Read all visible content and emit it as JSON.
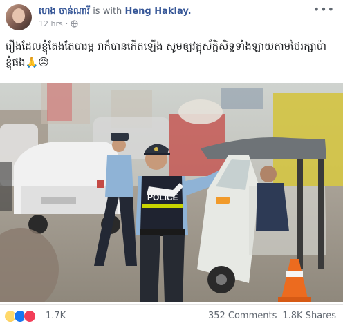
{
  "post": {
    "author": "ហេង ចាន់ណារី",
    "with_text": "is with",
    "tagged": "Heng Haklay.",
    "time": "12 hrs",
    "more": "•••",
    "caption": "រឿងដែលខ្ញុំតែងតែបារម្ភ រាក៏បានកើតឡើង សូមឲ្យវត្តុស័ក្តិសិទ្ធទាំងឡាយតាមថៃរក្សាប៉ាខ្ញុំផង🙏😥"
  },
  "photo": {
    "badge_text": "POLICE"
  },
  "footer": {
    "reactions": [
      "sad",
      "like",
      "love"
    ],
    "reaction_count": "1.7K",
    "comments": "352 Comments",
    "shares": "1.8K Shares"
  },
  "colors": {
    "link": "#385898",
    "uniform": "#8fb3d6",
    "vest": "#1f2330"
  }
}
